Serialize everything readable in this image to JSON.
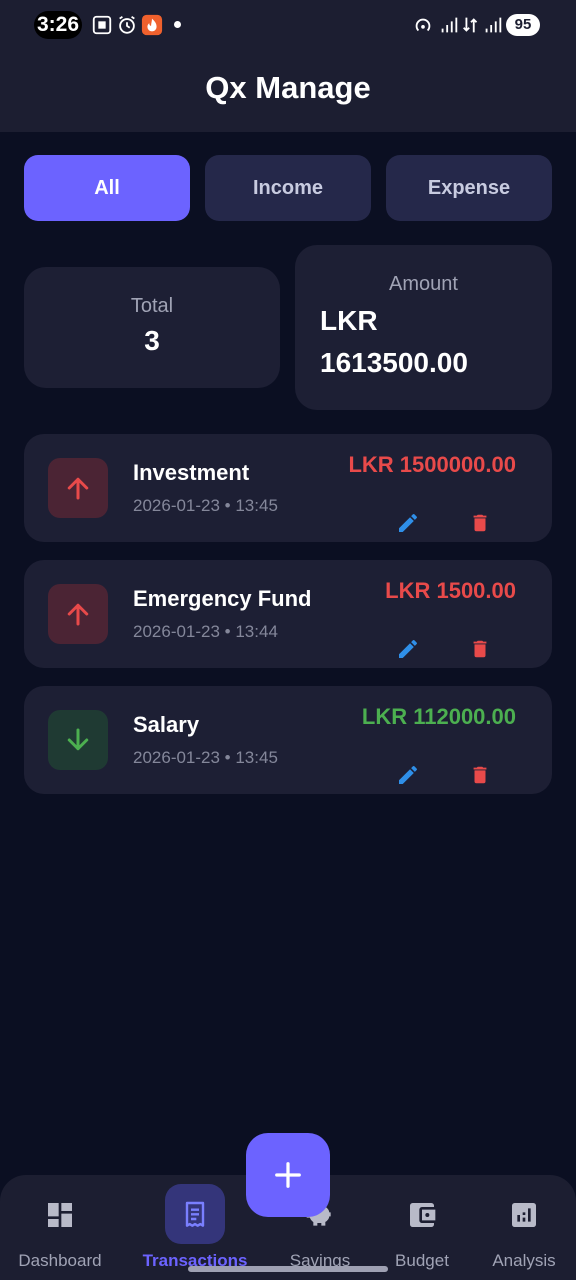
{
  "status_bar": {
    "time": "3:26",
    "battery": "95",
    "network": "4G"
  },
  "header": {
    "title": "Qx Manage"
  },
  "filters": {
    "tabs": [
      {
        "label": "All",
        "active": true
      },
      {
        "label": "Income",
        "active": false
      },
      {
        "label": "Expense",
        "active": false
      }
    ]
  },
  "summary": {
    "total_label": "Total",
    "total_value": "3",
    "amount_label": "Amount",
    "amount_currency": "LKR",
    "amount_value": "1613500.00"
  },
  "transactions": [
    {
      "name": "Investment",
      "datetime": "2026-01-23 • 13:45",
      "amount": "LKR 1500000.00",
      "type": "expense",
      "icon": "arrow-up-icon"
    },
    {
      "name": "Emergency Fund",
      "datetime": "2026-01-23 • 13:44",
      "amount": "LKR 1500.00",
      "type": "expense",
      "icon": "arrow-up-icon"
    },
    {
      "name": "Salary",
      "datetime": "2026-01-23 • 13:45",
      "amount": "LKR 112000.00",
      "type": "income",
      "icon": "arrow-down-icon"
    }
  ],
  "fab": {
    "icon": "plus-icon"
  },
  "bottom_nav": {
    "items": [
      {
        "label": "Dashboard",
        "icon": "dashboard-icon",
        "active": false
      },
      {
        "label": "Transactions",
        "icon": "receipt-icon",
        "active": true
      },
      {
        "label": "Savings",
        "icon": "piggy-bank-icon",
        "active": false
      },
      {
        "label": "Budget",
        "icon": "wallet-icon",
        "active": false
      },
      {
        "label": "Analysis",
        "icon": "analytics-icon",
        "active": false
      }
    ]
  },
  "colors": {
    "accent": "#6c63ff",
    "expense": "#e84a4a",
    "income": "#4caf50",
    "edit": "#2f8fe8",
    "background": "#0b0f22",
    "card": "#1d1f34"
  }
}
